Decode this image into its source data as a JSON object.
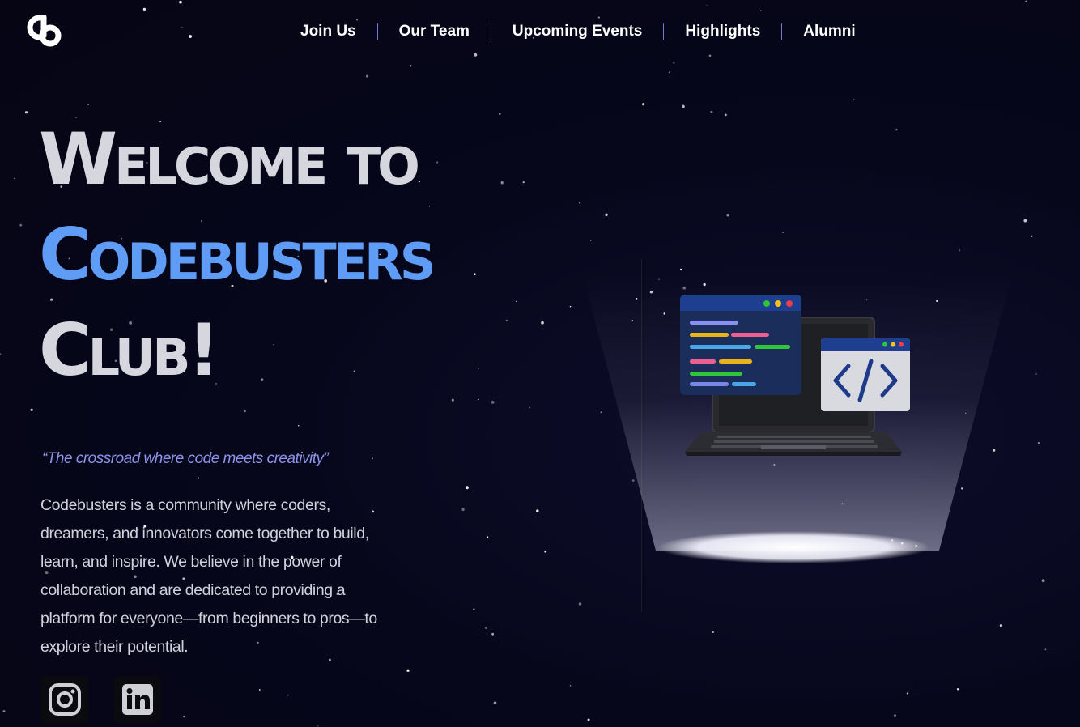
{
  "brand": {
    "logo_icon": "codebusters-logo-icon"
  },
  "nav": {
    "items": [
      {
        "label": "Join Us"
      },
      {
        "label": "Our Team"
      },
      {
        "label": "Upcoming Events"
      },
      {
        "label": "Highlights"
      },
      {
        "label": "Alumni"
      }
    ]
  },
  "hero": {
    "title_line1": "Welcome to",
    "title_line2": "Codebusters",
    "title_line3": "Club!",
    "tagline": "“The crossroad where code meets creativity”",
    "description": "Codebusters is a community where coders, dreamers, and innovators come together to build, learn, and inspire. We believe in the power of collaboration and are dedicated to providing a platform for everyone—from beginners to pros—to explore their potential."
  },
  "social": [
    {
      "icon": "instagram-icon"
    },
    {
      "icon": "linkedin-icon"
    }
  ],
  "colors": {
    "background": "#06061a",
    "accent_blue": "#5f9cf5",
    "title_grey": "#d6d6de",
    "tagline": "#8d93e8",
    "nav_divider": "#6f7bd6"
  }
}
